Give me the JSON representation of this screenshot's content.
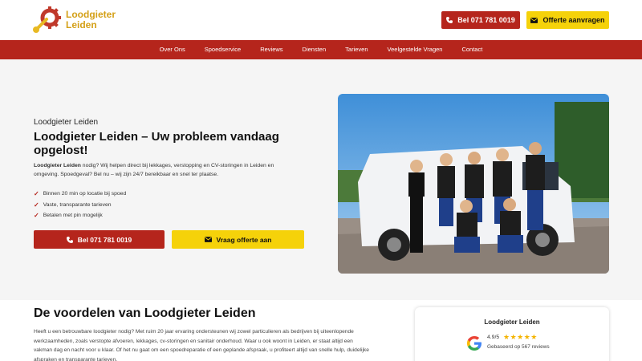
{
  "header": {
    "brand_line1": "Loodgieter",
    "brand_line2": "Leiden",
    "call_label": "Bel 071 781 0019",
    "offer_label": "Offerte aanvragen"
  },
  "nav": {
    "items": [
      "Over Ons",
      "Spoedservice",
      "Reviews",
      "Diensten",
      "Tarieven",
      "Veelgestelde Vragen",
      "Contact"
    ]
  },
  "hero": {
    "eyebrow": "Loodgieter Leiden",
    "title": "Loodgieter Leiden – Uw probleem vandaag opgelost!",
    "text_bold": "Loodgieter Leiden",
    "text_rest": " nodig? Wij helpen direct bij lekkages, verstopping en CV-storingen in Leiden en omgeving. Spoedgeval? Bel nu – wij zijn 24/7 bereikbaar en snel ter plaatse.",
    "checks": [
      "Binnen 20 min op locatie bij spoed",
      "Vaste, transparante tarieven",
      "Betalen met pin mogelijk"
    ],
    "call_label": "Bel 071 781 0019",
    "offer_label": "Vraag offerte aan"
  },
  "benefits": {
    "title": "De voordelen van Loodgieter Leiden",
    "text": "Heeft u een betrouwbare loodgieter nodig? Met ruim 20 jaar ervaring ondersteunen wij zowel particulieren als bedrijven bij uiteenlopende werkzaamheden, zoals verstopte afvoeren, lekkages, cv-storingen en sanitair onderhoud. Waar u ook woont in Leiden, er staat altijd een vakman dag en nacht voor u klaar. Of het nu gaat om een spoedreparatie of een geplande afspraak, u profiteert altijd van snelle hulp, duidelijke afspraken en transparante tarieven."
  },
  "review": {
    "name": "Loodgieter Leiden",
    "rating": "4.9/5",
    "stars": "★★★★★",
    "count": "Gebaseerd op 567 reviews"
  },
  "colors": {
    "red": "#b5251c",
    "yellow": "#f5d20a",
    "brand_gold": "#d4a017"
  }
}
